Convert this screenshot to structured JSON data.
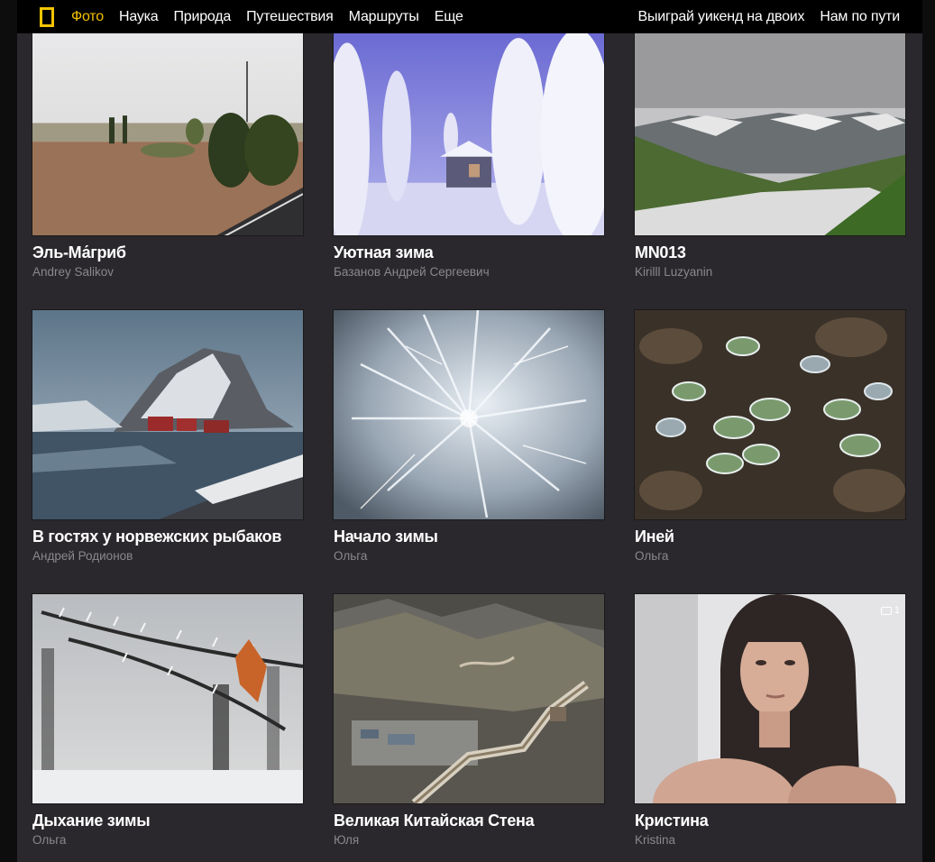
{
  "nav": {
    "left": [
      "Фото",
      "Наука",
      "Природа",
      "Путешествия",
      "Маршруты",
      "Еще"
    ],
    "right": [
      "Выиграй уикенд на двоих",
      "Нам по пути"
    ],
    "active_index": 0
  },
  "cards": [
    {
      "title": "Эль-Ма́гриб",
      "author": "Andrey Salikov"
    },
    {
      "title": "Уютная зима",
      "author": "Базанов Андрей Сергеевич"
    },
    {
      "title": "MN013",
      "author": "Kirilll Luzyanin"
    },
    {
      "title": "В гостях у норвежских рыбаков",
      "author": "Андрей Родионов"
    },
    {
      "title": "Начало зимы",
      "author": "Ольга"
    },
    {
      "title": "Иней",
      "author": "Ольга"
    },
    {
      "title": "Дыхание зимы",
      "author": "Ольга"
    },
    {
      "title": "Великая Китайская Стена",
      "author": "Юля"
    },
    {
      "title": "Кристина",
      "author": "Kristina",
      "comments": "1"
    }
  ],
  "colors": {
    "accent": "#f2c200",
    "background": "#2a282c",
    "topbar": "#000000",
    "author_text": "#8a888c"
  }
}
